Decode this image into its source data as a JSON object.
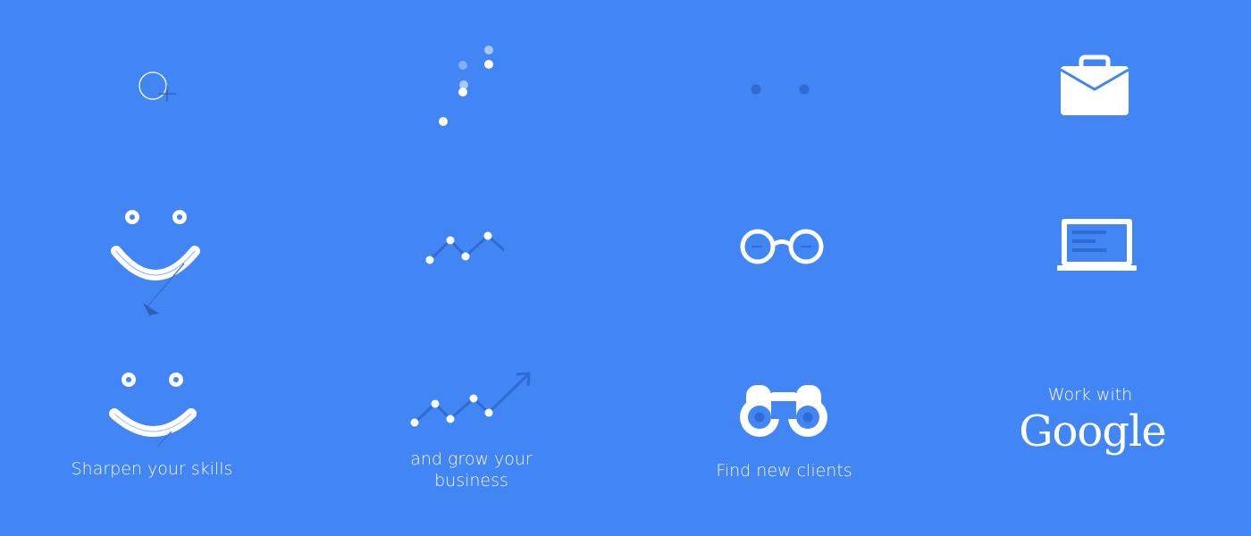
{
  "background_color": "#4285f4",
  "accent_dark": "#2f6bd3",
  "foreground_color": "#ffffff",
  "grid": {
    "row1": [
      {
        "icon": "circle-plus-cursor-icon"
      },
      {
        "icon": "scattered-dots-icon"
      },
      {
        "icon": "two-dots-icon"
      },
      {
        "icon": "briefcase-icon"
      }
    ],
    "row2": [
      {
        "icon": "smiley-face-drawing-icon"
      },
      {
        "icon": "zigzag-line-chart-icon"
      },
      {
        "icon": "glasses-icon"
      },
      {
        "icon": "laptop-icon"
      }
    ],
    "row3": [
      {
        "icon": "smiley-face-icon",
        "caption": "Sharpen your skills"
      },
      {
        "icon": "trending-up-chart-icon",
        "caption_line1": "and grow your",
        "caption_line2": "business"
      },
      {
        "icon": "binoculars-icon",
        "caption": "Find new clients"
      },
      {
        "brand_small": "Work with",
        "brand_big": "Google"
      }
    ]
  }
}
